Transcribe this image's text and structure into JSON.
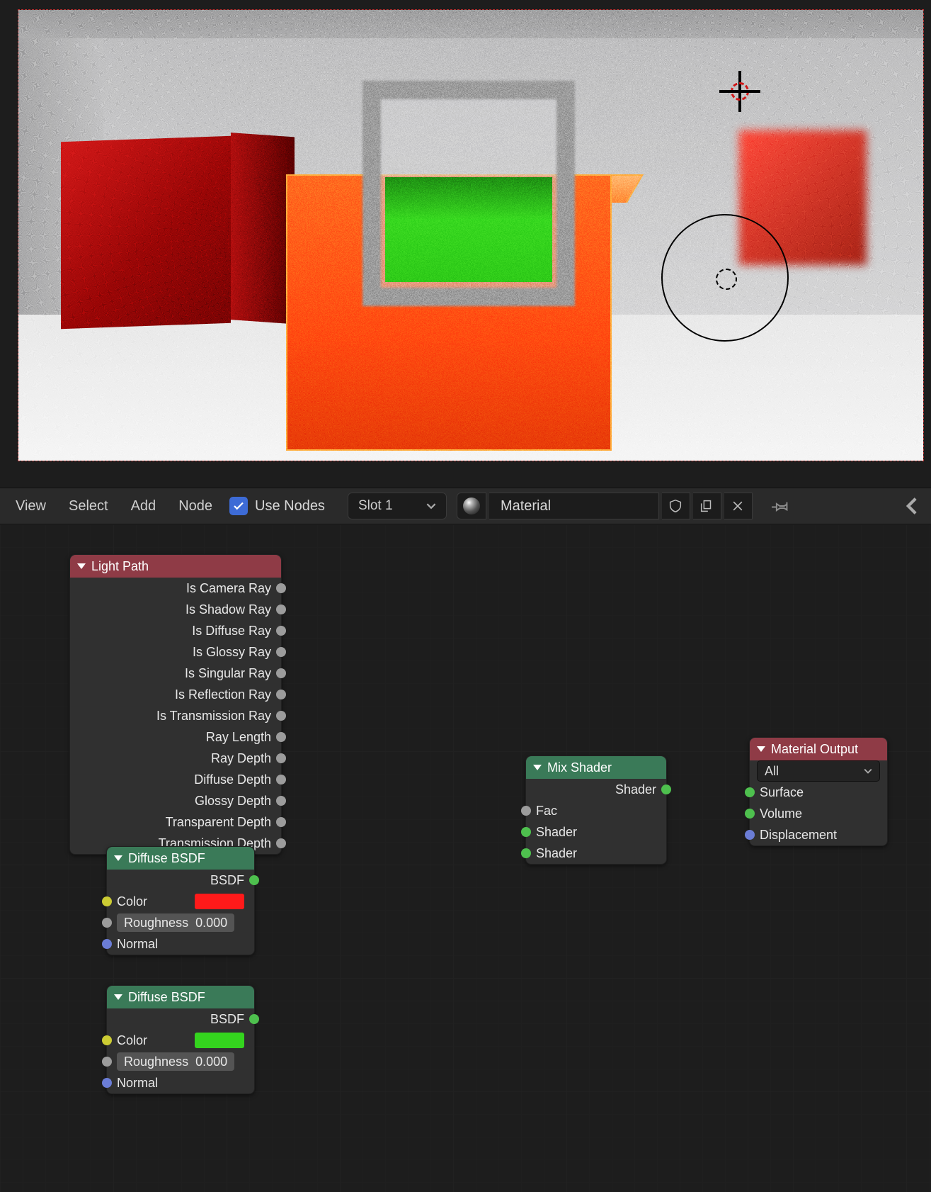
{
  "menubar": {
    "view": "View",
    "select": "Select",
    "add": "Add",
    "node": "Node",
    "use_nodes": "Use Nodes",
    "slot": "Slot 1",
    "material_name": "Material"
  },
  "nodes": {
    "light_path": {
      "title": "Light Path",
      "outputs": [
        "Is Camera Ray",
        "Is Shadow Ray",
        "Is Diffuse Ray",
        "Is Glossy Ray",
        "Is Singular Ray",
        "Is Reflection Ray",
        "Is Transmission Ray",
        "Ray Length",
        "Ray Depth",
        "Diffuse Depth",
        "Glossy Depth",
        "Transparent Depth",
        "Transmission Depth"
      ]
    },
    "diffuse1": {
      "title": "Diffuse BSDF",
      "out_label": "BSDF",
      "color_label": "Color",
      "color": "#ff1a1a",
      "roughness_label": "Roughness",
      "roughness_value": "0.000",
      "normal_label": "Normal"
    },
    "diffuse2": {
      "title": "Diffuse BSDF",
      "out_label": "BSDF",
      "color_label": "Color",
      "color": "#34d41e",
      "roughness_label": "Roughness",
      "roughness_value": "0.000",
      "normal_label": "Normal"
    },
    "mix": {
      "title": "Mix Shader",
      "out_label": "Shader",
      "fac_label": "Fac",
      "in1_label": "Shader",
      "in2_label": "Shader"
    },
    "output": {
      "title": "Material Output",
      "target": "All",
      "surface": "Surface",
      "volume": "Volume",
      "displacement": "Displacement"
    }
  }
}
